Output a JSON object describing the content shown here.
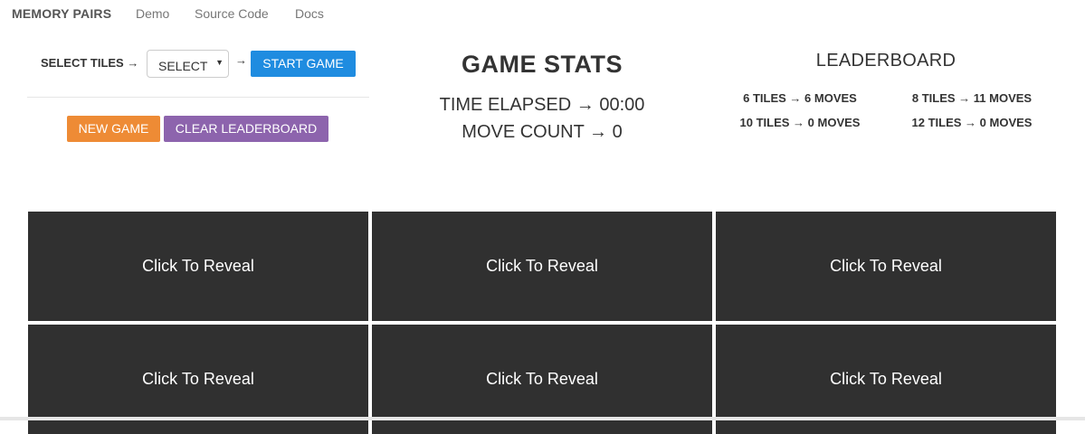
{
  "navbar": {
    "brand": "MEMORY PAIRS",
    "links": [
      "Demo",
      "Source Code",
      "Docs"
    ]
  },
  "controls": {
    "select_label": "SELECT TILES →",
    "select_value": "SELECT",
    "arrow": "→",
    "start_button": "START GAME",
    "new_game_button": "NEW GAME",
    "clear_leaderboard_button": "CLEAR LEADERBOARD"
  },
  "stats": {
    "title": "GAME STATS",
    "time_elapsed": "TIME ELAPSED → 00:00",
    "move_count": "MOVE COUNT → 0"
  },
  "leaderboard": {
    "title": "LEADERBOARD",
    "entries": [
      "6 TILES → 6 MOVES",
      "8 TILES → 11 MOVES",
      "10 TILES → 0 MOVES",
      "12 TILES → 0 MOVES"
    ]
  },
  "tiles": [
    "Click To Reveal",
    "Click To Reveal",
    "Click To Reveal",
    "Click To Reveal",
    "Click To Reveal",
    "Click To Reveal"
  ],
  "colors": {
    "start_button": "#1f8ce0",
    "new_game_button": "#ee8b35",
    "clear_button": "#8d64ad",
    "tile_background": "#303030"
  }
}
